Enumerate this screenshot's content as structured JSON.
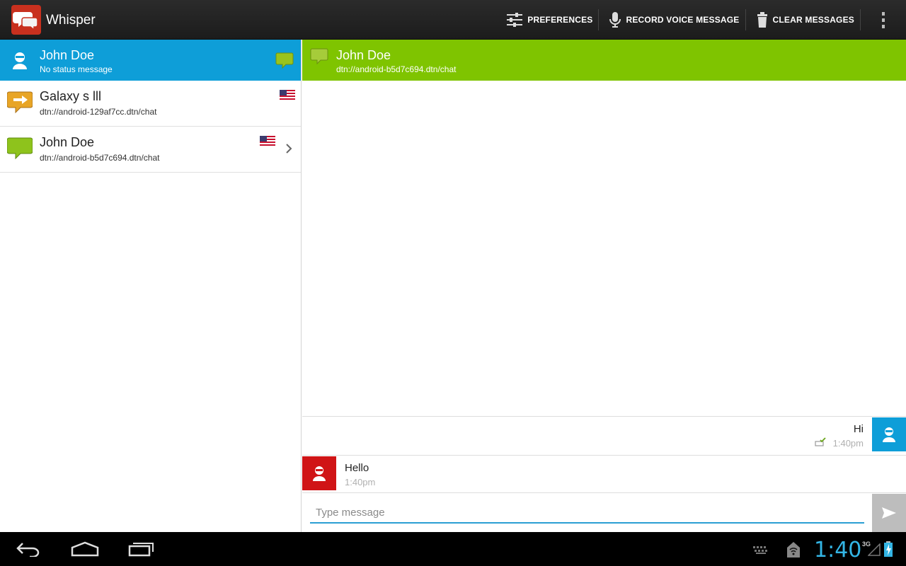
{
  "app": {
    "title": "Whisper",
    "brand_color": "#c8301e"
  },
  "actionbar": {
    "preferences_label": "PREFERENCES",
    "record_label": "RECORD VOICE MESSAGE",
    "clear_label": "CLEAR MESSAGES"
  },
  "contacts": {
    "me": {
      "name": "John Doe",
      "status": "No status message",
      "color": "#0e9ed8"
    },
    "items": [
      {
        "name": "Galaxy s lll",
        "address": "dtn://android-129af7cc.dtn/chat",
        "icon": "chat-arrow-icon"
      },
      {
        "name": "John Doe",
        "address": "dtn://android-b5d7c694.dtn/chat",
        "icon": "chat-bubble-green-icon"
      }
    ]
  },
  "conversation": {
    "header_name": "John Doe",
    "header_address": "dtn://android-b5d7c694.dtn/chat",
    "header_color": "#7fc400",
    "messages": [
      {
        "direction": "out",
        "text": "Hi",
        "time": "1:40pm"
      },
      {
        "direction": "in",
        "text": "Hello",
        "time": "1:40pm"
      }
    ],
    "composer_placeholder": "Type message"
  },
  "systembar": {
    "clock": "1:40",
    "network": "3G"
  }
}
